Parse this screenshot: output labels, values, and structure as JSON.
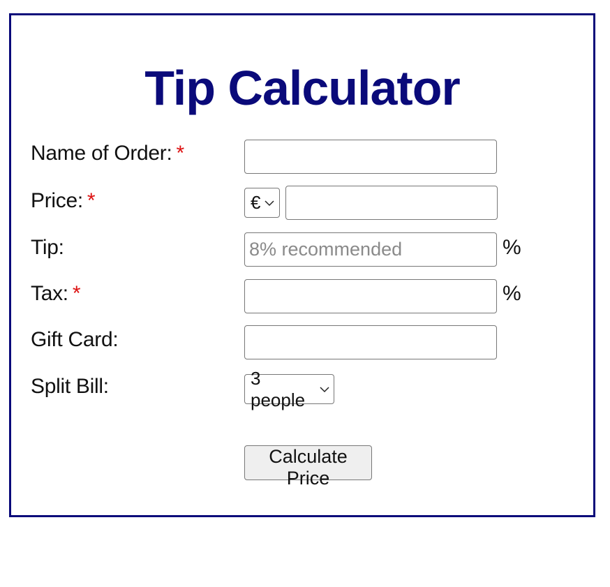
{
  "app": {
    "title": "Tip Calculator"
  },
  "form": {
    "name_label": "Name of Order:",
    "price_label": "Price:",
    "tip_label": "Tip:",
    "tax_label": "Tax:",
    "giftcard_label": "Gift Card:",
    "split_label": "Split Bill:",
    "required_marker": "*",
    "name_value": "",
    "price_value": "",
    "currency_selected": "€",
    "tip_value": "",
    "tip_placeholder": "8% recommended",
    "tip_suffix": "%",
    "tax_value": "",
    "tax_suffix": "%",
    "giftcard_value": "",
    "split_selected": "3 people",
    "submit_label": "Calculate Price"
  },
  "colors": {
    "title": "#0a0a7a",
    "border": "#0a0a7a",
    "required": "#dd1111"
  },
  "icons": {
    "dropdown": "chevron-down-icon"
  }
}
